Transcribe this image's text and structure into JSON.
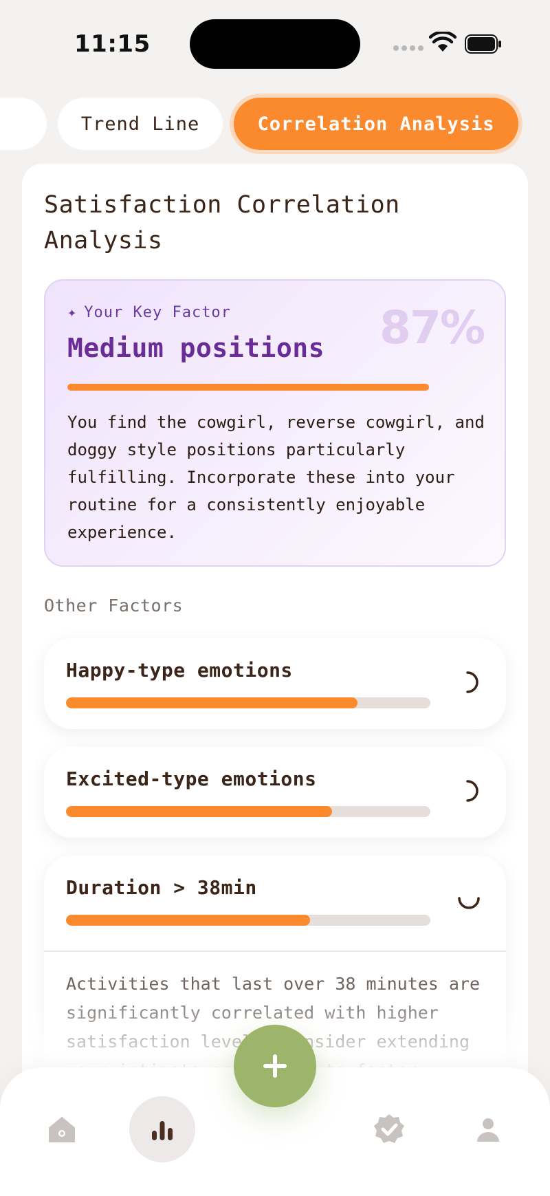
{
  "status_bar": {
    "time": "11:15"
  },
  "tabs": {
    "items": [
      {
        "label": ""
      },
      {
        "label": "Trend Line"
      },
      {
        "label": "Correlation Analysis",
        "active": true
      }
    ]
  },
  "card": {
    "title": "Satisfaction Correlation Analysis",
    "key_factor": {
      "label": "Your Key Factor",
      "icon": "sparkle-icon",
      "percent": "87%",
      "name": "Medium positions",
      "progress": 1.0,
      "description": "You find the cowgirl, reverse cowgirl, and doggy style positions particularly fulfilling. Incorporate these into your routine for a consistently enjoyable experience."
    },
    "other_factors_label": "Other Factors",
    "factors": [
      {
        "name": "Happy-type emotions",
        "progress": 0.8,
        "expanded": false
      },
      {
        "name": "Excited-type emotions",
        "progress": 0.73,
        "expanded": false
      },
      {
        "name": "Duration > 38min",
        "progress": 0.67,
        "expanded": true,
        "description": "Activities that last over 38 minutes are significantly correlated with higher satisfaction levels. Consider extending your intimate encounters to foster greater"
      }
    ]
  },
  "nav": {
    "items": [
      "home-icon",
      "stats-icon",
      "verified-icon",
      "profile-icon"
    ],
    "active": "stats-icon",
    "fab_icon": "plus-icon"
  },
  "colors": {
    "accent": "#fb8a2e",
    "purple": "#6a2c96",
    "fab": "#9cb56a",
    "text": "#3b2418"
  }
}
